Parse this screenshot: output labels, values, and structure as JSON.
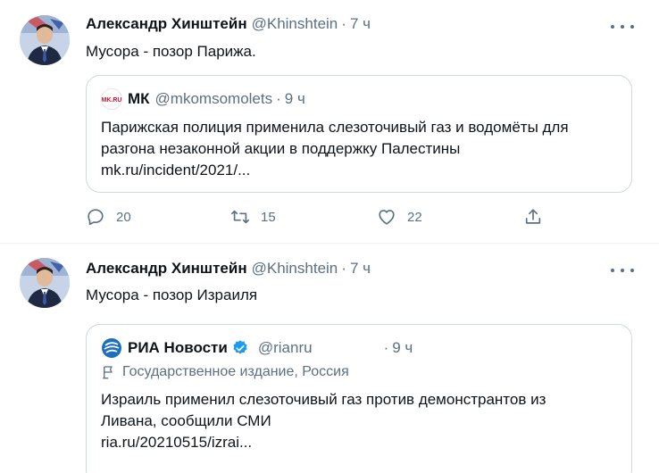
{
  "tweets": [
    {
      "author_name": "Александр Хинштейн",
      "author_handle": "@Khinshtein",
      "separator": "·",
      "time": "7 ч",
      "text": "Мусора - позор Парижа.",
      "quote": {
        "avatar_icon": "mk-logo-icon",
        "name": "МК",
        "handle": "@mkomsomolets",
        "separator": "·",
        "time": "9 ч",
        "body_line1": "Парижская полиция применила слезоточивый газ и водомёты для",
        "body_line2": "разгона незаконной акции в поддержку Палестины",
        "link": "mk.ru/incident/2021/..."
      },
      "actions": {
        "replies": "20",
        "retweets": "15",
        "likes": "22"
      }
    },
    {
      "author_name": "Александр Хинштейн",
      "author_handle": "@Khinshtein",
      "separator": "·",
      "time": "7 ч",
      "text": "Мусора - позор Израиля",
      "quote": {
        "avatar_icon": "ria-logo-icon",
        "name": "РИА Новости",
        "verified_icon": "verified-badge-icon",
        "handle": "@rianru",
        "separator": "·",
        "time": "9 ч",
        "label": "Государственное издание, Россия",
        "body_line1": "Израиль применил слезоточивый газ против демонстрантов из",
        "body_line2": "Ливана, сообщили СМИ",
        "link": "ria.ru/20210515/izrai..."
      }
    }
  ],
  "colors": {
    "text_primary": "#0f1419",
    "text_secondary": "#5b7083",
    "border": "#cfd9de",
    "verified_blue": "#1d9bf0",
    "ria_blue": "#1c6ebf"
  }
}
